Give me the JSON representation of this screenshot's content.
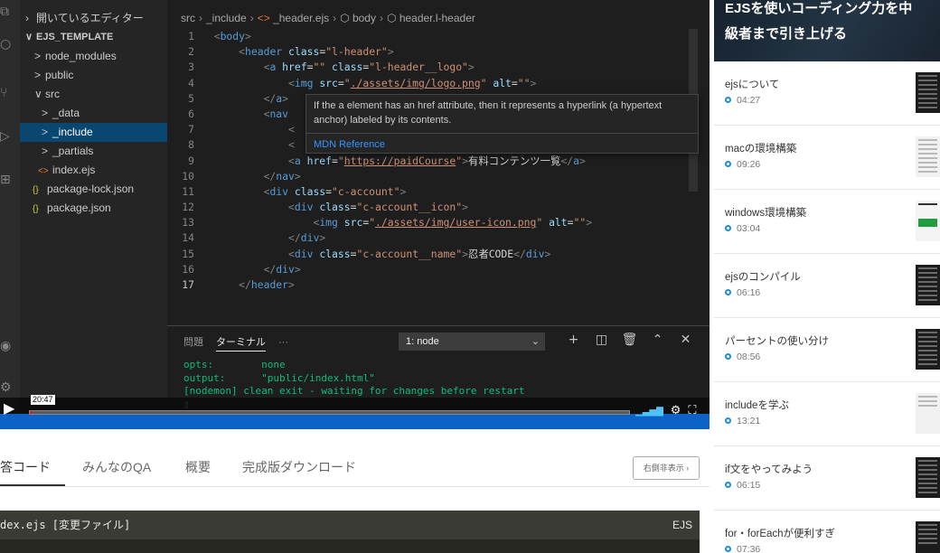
{
  "editor": {
    "explorer_title": "開いているエディター",
    "tree": [
      {
        "label": "EJS_TEMPLATE",
        "glyph": "∨",
        "depth": 0
      },
      {
        "label": "node_modules",
        "glyph": ">",
        "depth": 1
      },
      {
        "label": "public",
        "glyph": ">",
        "depth": 1
      },
      {
        "label": "src",
        "glyph": "∨",
        "depth": 1
      },
      {
        "label": "_data",
        "glyph": ">",
        "depth": 2
      },
      {
        "label": "_include",
        "glyph": ">",
        "depth": 2
      },
      {
        "label": "_partials",
        "glyph": ">",
        "depth": 2
      },
      {
        "label": "index.ejs",
        "glyph": "<>",
        "depth": 2
      },
      {
        "label": "package-lock.json",
        "glyph": "{}",
        "depth": 1
      },
      {
        "label": "package.json",
        "glyph": "{}",
        "depth": 1
      }
    ],
    "breadcrumb": [
      "src",
      "_include",
      "_header.ejs",
      "body",
      "header.l-header"
    ],
    "hover": {
      "text": "If the a element has an href attribute, then it represents a hyperlink (a hypertext anchor) labeled by its contents.",
      "link": "MDN Reference"
    },
    "line_numbers": [
      "1",
      "2",
      "3",
      "4",
      "5",
      "6",
      "7",
      "8",
      "9",
      "10",
      "11",
      "12",
      "13",
      "14",
      "15",
      "16",
      "17"
    ],
    "terminal": {
      "tabs": [
        "問題",
        "ターミナル",
        "···"
      ],
      "selector": "1: node",
      "lines": [
        "opts:        none",
        "output:      \"public/index.html\"",
        "[nodemon] clean exit - waiting for changes before restart",
        "▯"
      ]
    }
  },
  "player": {
    "time_label": "20:47",
    "progress": 0.005
  },
  "lecture_tabs": [
    "答コード",
    "みんなのQA",
    "概要",
    "完成版ダウンロード"
  ],
  "right_button": "右側非表示 ›",
  "file_bar": {
    "name": "dex.ejs [変更ファイル]",
    "lang": "EJS"
  },
  "sidebar": {
    "heading_line1": "EJSを使いコーディング力を中",
    "heading_line2": "級者まで引き上げる",
    "lessons": [
      {
        "title": "ejsについて",
        "duration": "04:27"
      },
      {
        "title": "macの環境構築",
        "duration": "09:26"
      },
      {
        "title": "windows環境構築",
        "duration": "03:04"
      },
      {
        "title": "ejsのコンパイル",
        "duration": "06:16"
      },
      {
        "title": "パーセントの使い分け",
        "duration": "08:56"
      },
      {
        "title": "includeを学ぶ",
        "duration": "13:21"
      },
      {
        "title": "if文をやってみよう",
        "duration": "06:15"
      },
      {
        "title": "for・forEachが便利すぎ",
        "duration": "07:36"
      }
    ]
  },
  "colors": {
    "accent": "#1f8ad6",
    "status_bar": "#0b63c7",
    "progress": "#d02020"
  }
}
